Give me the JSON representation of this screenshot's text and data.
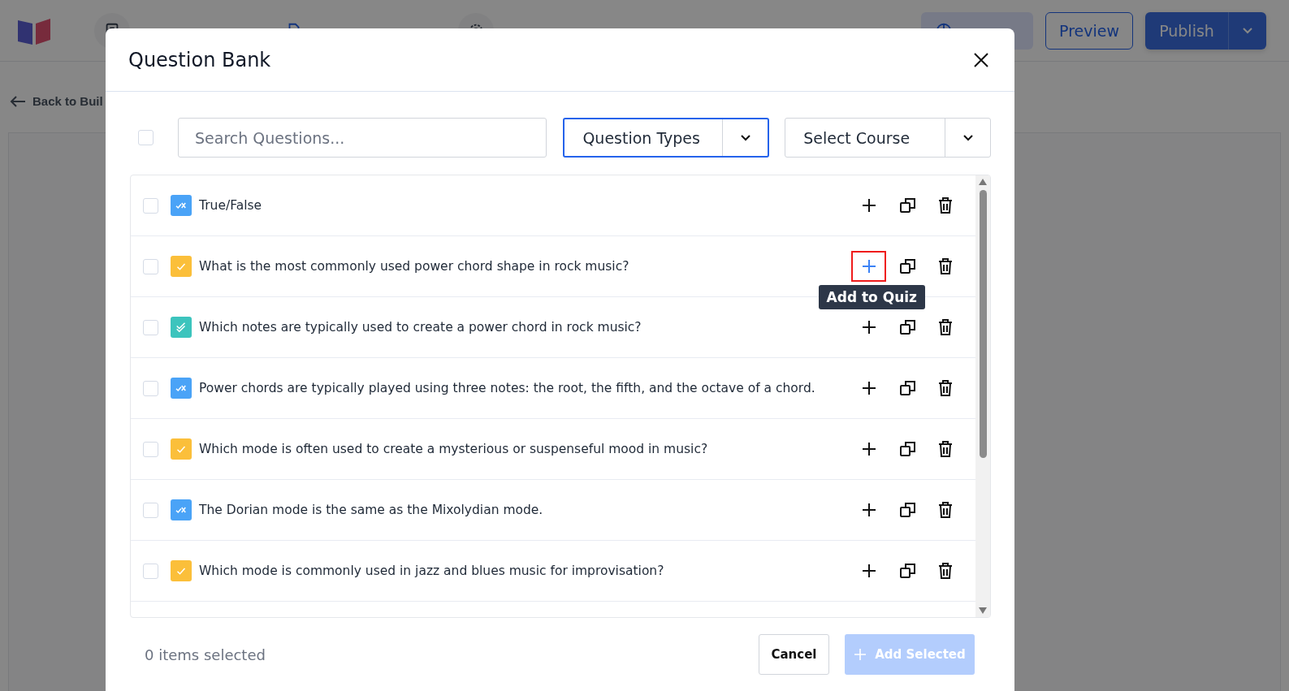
{
  "app_header": {
    "nav": [
      {
        "kind": "overview",
        "selected": false
      },
      {
        "kind": "builder",
        "selected": true
      },
      {
        "kind": "settings",
        "selected": false
      }
    ],
    "preview": "Preview",
    "publish": "Publish"
  },
  "back_link": "Back to Buil",
  "modal": {
    "title": "Question Bank",
    "select_all": {
      "checked": false
    },
    "search": {
      "placeholder": "Search Questions..."
    },
    "filters": [
      {
        "label": "Question Types",
        "focused": true
      },
      {
        "label": "Select Course",
        "focused": false
      }
    ],
    "questions": [
      {
        "text": "True/False",
        "kind": "true_false",
        "checked": false,
        "add_highlighted": false
      },
      {
        "text": "What is the most commonly used power chord shape in rock music?",
        "kind": "single_choice",
        "checked": false,
        "add_highlighted": true,
        "tooltip": "Add to Quiz"
      },
      {
        "text": "Which notes are typically used to create a power chord in rock music?",
        "kind": "multiple_choice",
        "checked": false,
        "add_highlighted": false
      },
      {
        "text": "Power chords are typically played using three notes: the root, the fifth, and the octave of a chord.",
        "kind": "true_false",
        "checked": false,
        "add_highlighted": false
      },
      {
        "text": "Which mode is often used to create a mysterious or suspenseful mood in music?",
        "kind": "single_choice",
        "checked": false,
        "add_highlighted": false
      },
      {
        "text": "The Dorian mode is the same as the Mixolydian mode.",
        "kind": "true_false",
        "checked": false,
        "add_highlighted": false
      },
      {
        "text": "Which mode is commonly used in jazz and blues music for improvisation?",
        "kind": "single_choice",
        "checked": false,
        "add_highlighted": false
      }
    ],
    "selection_count": "0 items selected",
    "cancel": "Cancel",
    "add_selected": {
      "label": "Add Selected",
      "disabled": true
    }
  }
}
